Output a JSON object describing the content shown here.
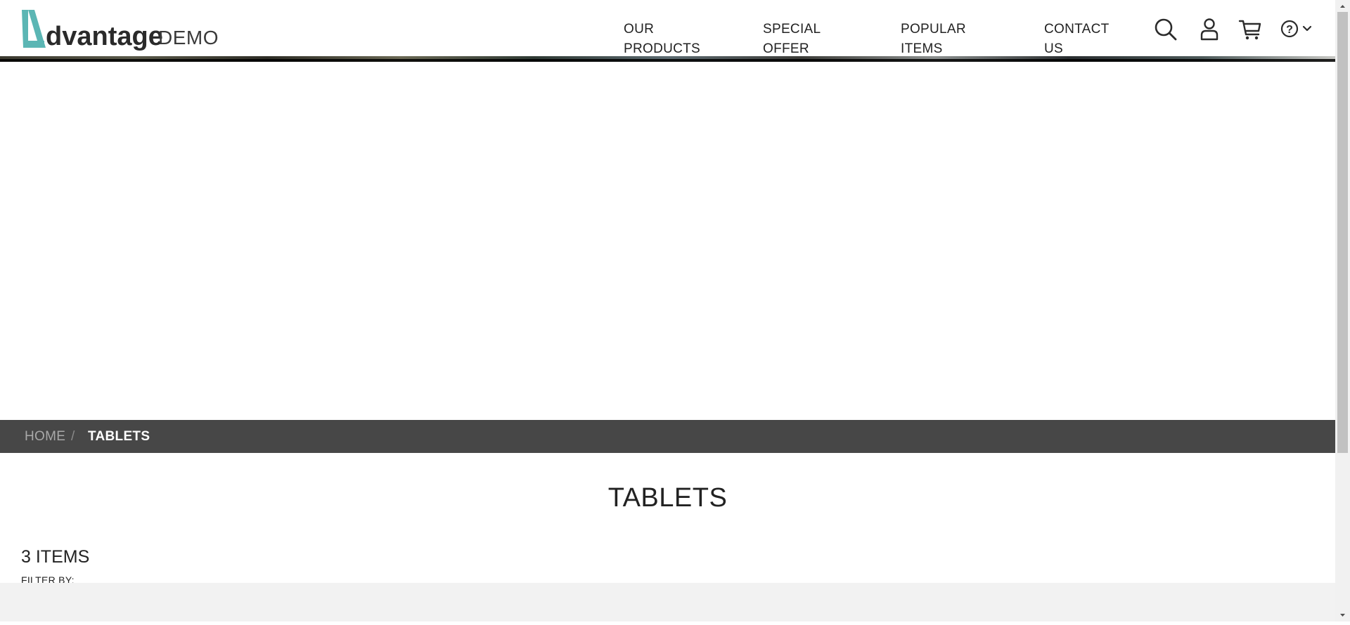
{
  "header": {
    "logo": {
      "brand": "dvantage",
      "suffix": "DEMO",
      "accent_color": "#5bb6b4"
    },
    "nav": [
      {
        "label": "OUR PRODUCTS"
      },
      {
        "label": "SPECIAL OFFER"
      },
      {
        "label": "POPULAR ITEMS"
      },
      {
        "label": "CONTACT US"
      }
    ],
    "icons": [
      "search-icon",
      "user-icon",
      "cart-icon",
      "help-icon"
    ]
  },
  "breadcrumb": {
    "home": "HOME",
    "separator": "/",
    "current": "TABLETS"
  },
  "main": {
    "title": "TABLETS",
    "items_count": "3 ITEMS",
    "filter_label": "FILTER BY:"
  },
  "colors": {
    "breadcrumb_bg": "#474747",
    "bottom_bar": "#f2f2f2",
    "accent": "#5bb6b4"
  }
}
